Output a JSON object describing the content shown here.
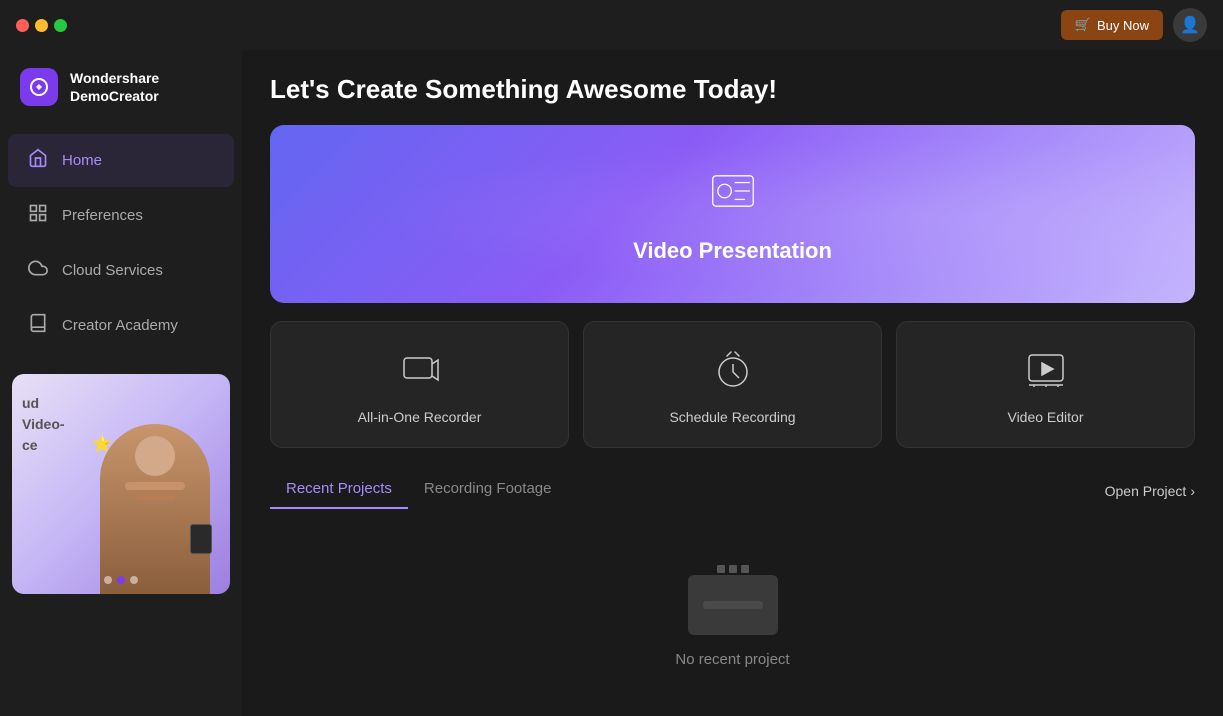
{
  "titlebar": {
    "buy_now_label": "Buy Now",
    "cart_icon": "🛒"
  },
  "sidebar": {
    "brand_name": "Wondershare\nDemoCreator",
    "nav_items": [
      {
        "id": "home",
        "label": "Home",
        "icon": "home",
        "active": true
      },
      {
        "id": "preferences",
        "label": "Preferences",
        "icon": "grid",
        "active": false
      },
      {
        "id": "cloud",
        "label": "Cloud Services",
        "icon": "cloud",
        "active": false
      },
      {
        "id": "academy",
        "label": "Creator Academy",
        "icon": "book",
        "active": false
      }
    ],
    "preview_text": "ud\nVideo-\nce"
  },
  "main": {
    "page_title": "Let's Create Something Awesome Today!",
    "hero": {
      "label": "Video Presentation"
    },
    "cards": [
      {
        "id": "recorder",
        "label": "All-in-One Recorder"
      },
      {
        "id": "schedule",
        "label": "Schedule Recording"
      },
      {
        "id": "editor",
        "label": "Video Editor"
      }
    ],
    "tabs": [
      {
        "id": "recent",
        "label": "Recent Projects",
        "active": true
      },
      {
        "id": "footage",
        "label": "Recording Footage",
        "active": false
      }
    ],
    "open_project_label": "Open Project",
    "empty_state_text": "No recent project"
  }
}
